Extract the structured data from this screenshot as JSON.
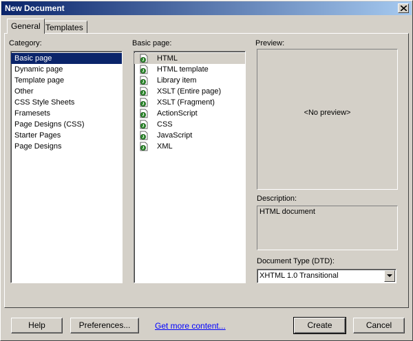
{
  "window": {
    "title": "New Document"
  },
  "tabs": [
    {
      "label": "General"
    },
    {
      "label": "Templates"
    }
  ],
  "category": {
    "label": "Category:",
    "items": [
      "Basic page",
      "Dynamic page",
      "Template page",
      "Other",
      "CSS Style Sheets",
      "Framesets",
      "Page Designs (CSS)",
      "Starter Pages",
      "Page Designs"
    ],
    "selected": "Basic page"
  },
  "basic_page": {
    "label": "Basic page:",
    "items": [
      "HTML",
      "HTML template",
      "Library item",
      "XSLT (Entire page)",
      "XSLT (Fragment)",
      "ActionScript",
      "CSS",
      "JavaScript",
      "XML"
    ],
    "selected": "HTML",
    "item_icon": "document-page-icon"
  },
  "preview": {
    "label": "Preview:",
    "text": "<No preview>"
  },
  "description": {
    "label": "Description:",
    "text": "HTML document"
  },
  "doctype": {
    "label": "Document Type (DTD):",
    "value": "XHTML 1.0 Transitional"
  },
  "footer": {
    "help": "Help",
    "preferences": "Preferences...",
    "more_content": "Get more content...",
    "create": "Create",
    "cancel": "Cancel"
  },
  "colors": {
    "title_start": "#0a246a",
    "title_end": "#a6caf0",
    "selection": "#0a246a",
    "face": "#d4d0c8",
    "link": "#0000ff"
  }
}
